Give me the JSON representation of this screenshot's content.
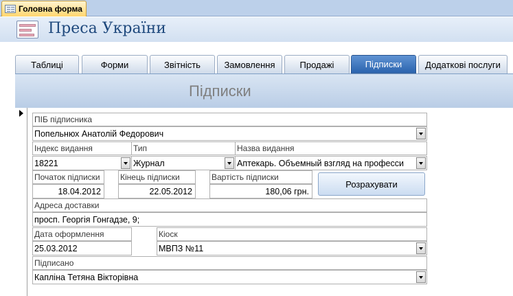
{
  "document_tab": {
    "label": "Головна форма"
  },
  "header": {
    "title": "Преса України"
  },
  "nav": {
    "tabs": [
      {
        "label": "Таблиці"
      },
      {
        "label": "Форми"
      },
      {
        "label": "Звітність"
      },
      {
        "label": "Замовлення"
      },
      {
        "label": "Продажі"
      },
      {
        "label": "Підписки",
        "active": true
      },
      {
        "label": "Додаткові послуги"
      }
    ]
  },
  "form": {
    "title": "Підписки",
    "subscriber": {
      "label": "ПІБ підписника",
      "value": "Попельнюх Анатолій Федорович"
    },
    "edition_index": {
      "label": "Індекс видання",
      "value": "18221"
    },
    "type": {
      "label": "Тип",
      "value": "Журнал"
    },
    "edition_name": {
      "label": "Назва видання",
      "value": "Аптекарь. Объемный взгляд на професси"
    },
    "start": {
      "label": "Початок підписки",
      "value": "18.04.2012"
    },
    "end": {
      "label": "Кінець підписки",
      "value": "22.05.2012"
    },
    "cost": {
      "label": "Вартість підписки",
      "value": "180,06 грн."
    },
    "calculate_button": "Розрахувати",
    "address": {
      "label": "Адреса доставки",
      "value": "просп. Георгія Гонгадзе, 9;"
    },
    "date": {
      "label": "Дата оформлення",
      "value": "25.03.2012"
    },
    "kiosk": {
      "label": "Кіоск",
      "value": "МВПЗ №11"
    },
    "signed": {
      "label": "Підписано",
      "value": "Капліна Тетяна Вікторівна"
    }
  },
  "colors": {
    "active_tab": "#2b64ae",
    "app_title": "#1f497d",
    "form_title": "#7f7f7f"
  }
}
